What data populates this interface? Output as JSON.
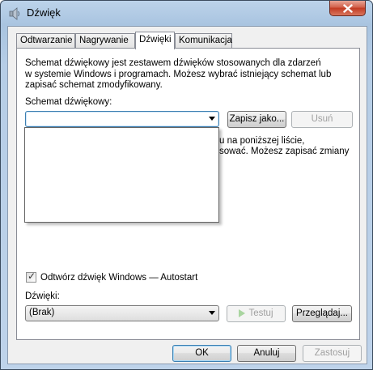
{
  "window": {
    "title": "Dźwięk",
    "icons": {
      "app": "speaker-icon",
      "close": "close-icon"
    },
    "colors": {
      "close": "#c23b22",
      "accent": "#3c7fb1"
    }
  },
  "tabs": [
    {
      "label": "Odtwarzanie",
      "active": false
    },
    {
      "label": "Nagrywanie",
      "active": false
    },
    {
      "label": "Dźwięki",
      "active": true
    },
    {
      "label": "Komunikacja",
      "active": false
    }
  ],
  "description": [
    "Schemat dźwiękowy jest zestawem dźwięków stosowanych dla zdarzeń",
    "w systemie Windows i programach. Możesz wybrać istniejący schemat lub",
    "zapisać schemat zmodyfikowany."
  ],
  "scheme": {
    "label": "Schemat dźwiękowy:",
    "value": "",
    "save_button": "Zapisz jako...",
    "delete_button": "Usuń"
  },
  "events_text_partial": [
    "u na poniższej liście,",
    "sować. Możesz zapisać zmiany"
  ],
  "autostart_checkbox": {
    "label": "Odtwórz dźwięk Windows — Autostart",
    "checked": true
  },
  "sounds": {
    "label": "Dźwięki:",
    "value": "(Brak)",
    "test_button": "Testuj",
    "browse_button": "Przeglądaj..."
  },
  "footer": {
    "ok": "OK",
    "cancel": "Anuluj",
    "apply": "Zastosuj"
  }
}
